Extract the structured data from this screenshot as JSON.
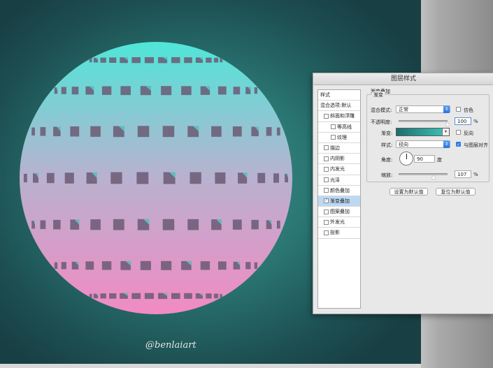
{
  "watermark": "@benlaiart",
  "colors": {
    "sphere_top": "#4fe6d8",
    "sphere_mid": "#b9b1cf",
    "sphere_bottom": "#f28ac4",
    "square_fill": "#6b5a74",
    "gradient_start": "#1d6e6c",
    "gradient_end": "#3fc9c0"
  },
  "dialog": {
    "title": "图层样式",
    "styles_header": "样式",
    "blend_options": "混合选项:默认",
    "style_items": [
      {
        "label": "斜面和浮雕",
        "checked": false,
        "indent": 0
      },
      {
        "label": "等高线",
        "checked": false,
        "indent": 1
      },
      {
        "label": "纹理",
        "checked": false,
        "indent": 1
      },
      {
        "label": "描边",
        "checked": false,
        "indent": 0
      },
      {
        "label": "内阴影",
        "checked": false,
        "indent": 0
      },
      {
        "label": "内发光",
        "checked": false,
        "indent": 0
      },
      {
        "label": "光泽",
        "checked": false,
        "indent": 0
      },
      {
        "label": "颜色叠加",
        "checked": false,
        "indent": 0
      },
      {
        "label": "渐变叠加",
        "checked": true,
        "indent": 0,
        "selected": true
      },
      {
        "label": "图案叠加",
        "checked": false,
        "indent": 0
      },
      {
        "label": "外发光",
        "checked": false,
        "indent": 0
      },
      {
        "label": "投影",
        "checked": false,
        "indent": 0
      }
    ],
    "panel_title": "渐变叠加",
    "group_label": "渐变",
    "blend_mode_label": "混合模式:",
    "blend_mode_value": "正常",
    "dither_label": "仿色",
    "opacity_label": "不透明度:",
    "opacity_value": "100",
    "percent": "%",
    "reverse_label": "反向",
    "gradient_label": "渐变:",
    "style_label": "样式:",
    "style_value": "径向",
    "align_label": "与图层对齐",
    "angle_label": "角度:",
    "angle_value": "90",
    "degree": "度",
    "scale_label": "缩放:",
    "scale_value": "107",
    "set_default": "设置为默认值",
    "reset_default": "复位为默认值",
    "opacity_fraction": 1.0,
    "scale_fraction": 0.71,
    "dither_checked": false,
    "reverse_checked": false,
    "align_checked": true
  }
}
